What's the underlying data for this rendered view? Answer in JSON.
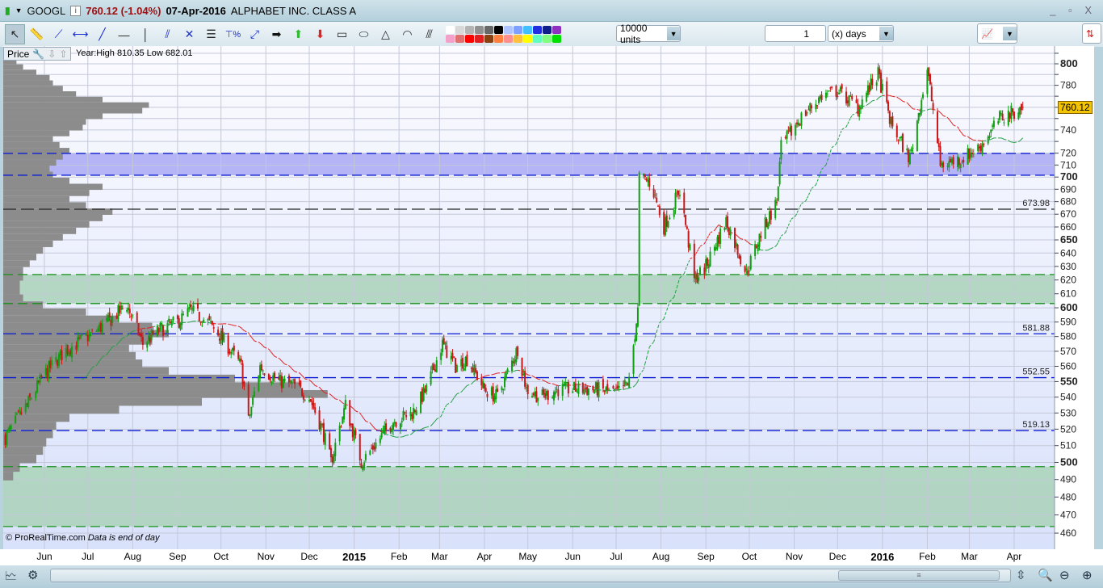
{
  "header": {
    "symbol": "GOOGL",
    "price_change": "760.12 (-1.04%)",
    "date": "07-Apr-2016",
    "name": "ALPHABET INC. CLASS A",
    "window_controls": "_ ▫ X"
  },
  "toolbar": {
    "units": "10000 units",
    "period_value": "1",
    "period_unit": "(x) days",
    "colors": [
      "#ffffff",
      "#d8d8d8",
      "#b4b4b4",
      "#909090",
      "#686868",
      "#000000",
      "#b0c4ff",
      "#7fa0ff",
      "#40c0ff",
      "#2030e0",
      "#10208a",
      "#9030c0",
      "#f4a0c8",
      "#e07070",
      "#ff0000",
      "#e02020",
      "#8a4010",
      "#ff8040",
      "#ff9090",
      "#ffc040",
      "#ffff00",
      "#60ffc0",
      "#80ff80",
      "#00e000",
      "#30b030",
      "#008000"
    ]
  },
  "panel": {
    "label": "Price",
    "year_info": "Year:High 810.35 Low 682.01",
    "credit": "© ProRealTime.com",
    "credit_note": "Data is end of day",
    "last_price": "760.12"
  },
  "chart_data": {
    "type": "candlestick",
    "symbol": "GOOGL",
    "scale": "log",
    "ylim": [
      455,
      815
    ],
    "ytick_labels": [
      "800",
      "780",
      "740",
      "720",
      "710",
      "700",
      "690",
      "680",
      "670",
      "660",
      "650",
      "640",
      "630",
      "620",
      "610",
      "600",
      "590",
      "580",
      "570",
      "560",
      "550",
      "540",
      "530",
      "520",
      "510",
      "500",
      "490",
      "480",
      "470",
      "460"
    ],
    "bold_ticks": [
      "800",
      "700",
      "650",
      "600",
      "550",
      "500"
    ],
    "xtick_labels": [
      {
        "d": "2014-06-01",
        "t": "Jun"
      },
      {
        "d": "2014-07-01",
        "t": "Jul"
      },
      {
        "d": "2014-08-01",
        "t": "Aug"
      },
      {
        "d": "2014-09-01",
        "t": "Sep"
      },
      {
        "d": "2014-10-01",
        "t": "Oct"
      },
      {
        "d": "2014-11-01",
        "t": "Nov"
      },
      {
        "d": "2014-12-01",
        "t": "Dec"
      },
      {
        "d": "2015-01-01",
        "t": "2015",
        "year": true
      },
      {
        "d": "2015-02-01",
        "t": "Feb"
      },
      {
        "d": "2015-03-01",
        "t": "Mar"
      },
      {
        "d": "2015-04-01",
        "t": "Apr"
      },
      {
        "d": "2015-05-01",
        "t": "May"
      },
      {
        "d": "2015-06-01",
        "t": "Jun"
      },
      {
        "d": "2015-07-01",
        "t": "Jul"
      },
      {
        "d": "2015-08-01",
        "t": "Aug"
      },
      {
        "d": "2015-09-01",
        "t": "Sep"
      },
      {
        "d": "2015-10-01",
        "t": "Oct"
      },
      {
        "d": "2015-11-01",
        "t": "Nov"
      },
      {
        "d": "2015-12-01",
        "t": "Dec"
      },
      {
        "d": "2016-01-01",
        "t": "2016",
        "year": true
      },
      {
        "d": "2016-02-01",
        "t": "Feb"
      },
      {
        "d": "2016-03-01",
        "t": "Mar"
      },
      {
        "d": "2016-04-01",
        "t": "Apr"
      }
    ],
    "close_anchors": [
      [
        "2014-05-05",
        515
      ],
      [
        "2014-05-20",
        535
      ],
      [
        "2014-06-01",
        555
      ],
      [
        "2014-06-15",
        570
      ],
      [
        "2014-07-01",
        580
      ],
      [
        "2014-07-15",
        590
      ],
      [
        "2014-07-28",
        602
      ],
      [
        "2014-08-08",
        575
      ],
      [
        "2014-08-20",
        585
      ],
      [
        "2014-09-01",
        590
      ],
      [
        "2014-09-10",
        598
      ],
      [
        "2014-09-22",
        590
      ],
      [
        "2014-10-01",
        580
      ],
      [
        "2014-10-15",
        560
      ],
      [
        "2014-10-20",
        525
      ],
      [
        "2014-10-28",
        560
      ],
      [
        "2014-11-10",
        550
      ],
      [
        "2014-11-20",
        548
      ],
      [
        "2014-12-01",
        540
      ],
      [
        "2014-12-10",
        520
      ],
      [
        "2014-12-16",
        500
      ],
      [
        "2014-12-26",
        535
      ],
      [
        "2015-01-06",
        500
      ],
      [
        "2015-01-15",
        510
      ],
      [
        "2015-01-28",
        525
      ],
      [
        "2015-02-10",
        530
      ],
      [
        "2015-02-20",
        545
      ],
      [
        "2015-03-03",
        575
      ],
      [
        "2015-03-12",
        560
      ],
      [
        "2015-03-20",
        565
      ],
      [
        "2015-04-01",
        545
      ],
      [
        "2015-04-10",
        540
      ],
      [
        "2015-04-24",
        572
      ],
      [
        "2015-04-30",
        545
      ],
      [
        "2015-05-10",
        540
      ],
      [
        "2015-05-22",
        545
      ],
      [
        "2015-06-05",
        545
      ],
      [
        "2015-06-20",
        545
      ],
      [
        "2015-07-01",
        542
      ],
      [
        "2015-07-10",
        550
      ],
      [
        "2015-07-16",
        598
      ],
      [
        "2015-07-17",
        700
      ],
      [
        "2015-07-25",
        695
      ],
      [
        "2015-08-03",
        660
      ],
      [
        "2015-08-14",
        690
      ],
      [
        "2015-08-24",
        620
      ],
      [
        "2015-09-01",
        630
      ],
      [
        "2015-09-15",
        665
      ],
      [
        "2015-09-29",
        625
      ],
      [
        "2015-10-09",
        655
      ],
      [
        "2015-10-20",
        680
      ],
      [
        "2015-10-23",
        725
      ],
      [
        "2015-11-05",
        750
      ],
      [
        "2015-11-20",
        770
      ],
      [
        "2015-12-01",
        775
      ],
      [
        "2015-12-15",
        760
      ],
      [
        "2015-12-29",
        790
      ],
      [
        "2016-01-07",
        745
      ],
      [
        "2016-01-20",
        715
      ],
      [
        "2016-02-01",
        795
      ],
      [
        "2016-02-10",
        710
      ],
      [
        "2016-02-24",
        715
      ],
      [
        "2016-03-08",
        725
      ],
      [
        "2016-03-22",
        750
      ],
      [
        "2016-04-07",
        760.12
      ]
    ],
    "moving_average_period": 40,
    "zones": [
      {
        "from": 701.5,
        "to": 719.8,
        "color": "#a8a8f5"
      },
      {
        "from": 603,
        "to": 624,
        "color": "#a9d2b7"
      },
      {
        "from": 463.6,
        "to": 497.5,
        "color": "#a9d2b7"
      }
    ],
    "levels": [
      {
        "value": 673.98,
        "label": "673.98",
        "color": "#222222"
      },
      {
        "value": 581.88,
        "label": "581.88",
        "color": "#0a1ad0"
      },
      {
        "value": 552.55,
        "label": "552.55",
        "color": "#0a1ad0"
      },
      {
        "value": 519.13,
        "label": "519.13",
        "color": "#0a1ad0"
      }
    ],
    "volume_profile": [
      [
        492,
        0.03
      ],
      [
        497,
        0.05
      ],
      [
        502,
        0.1
      ],
      [
        507,
        0.12
      ],
      [
        512,
        0.13
      ],
      [
        517,
        0.15
      ],
      [
        522,
        0.16
      ],
      [
        527,
        0.2
      ],
      [
        532,
        0.35
      ],
      [
        537,
        0.6
      ],
      [
        542,
        0.98
      ],
      [
        547,
        0.9
      ],
      [
        552,
        0.7
      ],
      [
        557,
        0.5
      ],
      [
        562,
        0.42
      ],
      [
        567,
        0.4
      ],
      [
        572,
        0.38
      ],
      [
        577,
        0.45
      ],
      [
        582,
        0.5
      ],
      [
        587,
        0.45
      ],
      [
        592,
        0.35
      ],
      [
        597,
        0.25
      ],
      [
        602,
        0.12
      ],
      [
        607,
        0.06
      ],
      [
        612,
        0.05
      ],
      [
        617,
        0.05
      ],
      [
        622,
        0.06
      ],
      [
        627,
        0.06
      ],
      [
        632,
        0.08
      ],
      [
        637,
        0.1
      ],
      [
        642,
        0.12
      ],
      [
        647,
        0.15
      ],
      [
        652,
        0.18
      ],
      [
        657,
        0.22
      ],
      [
        662,
        0.26
      ],
      [
        667,
        0.3
      ],
      [
        672,
        0.33
      ],
      [
        677,
        0.25
      ],
      [
        682,
        0.2
      ],
      [
        687,
        0.26
      ],
      [
        692,
        0.3
      ],
      [
        697,
        0.2
      ],
      [
        702,
        0.15
      ],
      [
        707,
        0.14
      ],
      [
        712,
        0.16
      ],
      [
        717,
        0.18
      ],
      [
        722,
        0.2
      ],
      [
        727,
        0.17
      ],
      [
        732,
        0.15
      ],
      [
        737,
        0.2
      ],
      [
        742,
        0.24
      ],
      [
        747,
        0.25
      ],
      [
        752,
        0.3
      ],
      [
        757,
        0.42
      ],
      [
        762,
        0.44
      ],
      [
        767,
        0.3
      ],
      [
        772,
        0.22
      ],
      [
        777,
        0.18
      ],
      [
        782,
        0.15
      ],
      [
        787,
        0.14
      ],
      [
        792,
        0.1
      ],
      [
        797,
        0.06
      ],
      [
        802,
        0.04
      ],
      [
        807,
        0.03
      ]
    ]
  }
}
